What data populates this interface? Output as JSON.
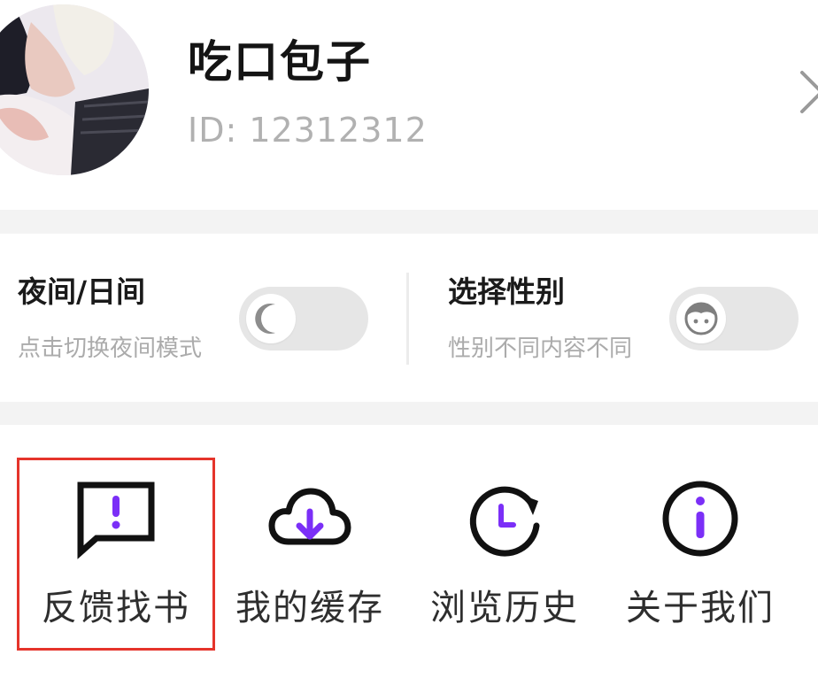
{
  "profile": {
    "username": "吃口包子",
    "user_id": "ID: 12312312",
    "avatar_icon": "user-avatar-illustration",
    "chevron_icon": "chevron-right-icon"
  },
  "toggles": {
    "night_mode": {
      "title": "夜间/日间",
      "subtitle": "点击切换夜间模式",
      "icon": "moon-icon",
      "on": false
    },
    "gender": {
      "title": "选择性别",
      "subtitle": "性别不同内容不同",
      "icon": "face-icon",
      "on": false
    }
  },
  "menu": {
    "items": [
      {
        "label": "反馈找书",
        "icon": "feedback-icon"
      },
      {
        "label": "我的缓存",
        "icon": "cloud-download-icon"
      },
      {
        "label": "浏览历史",
        "icon": "history-icon"
      },
      {
        "label": "关于我们",
        "icon": "info-icon"
      }
    ]
  },
  "colors": {
    "accent": "#7b2ff7",
    "icon_stroke": "#111111",
    "highlight": "#e5342b",
    "band": "#f3f3f3",
    "switch_track": "#e6e6e6"
  }
}
